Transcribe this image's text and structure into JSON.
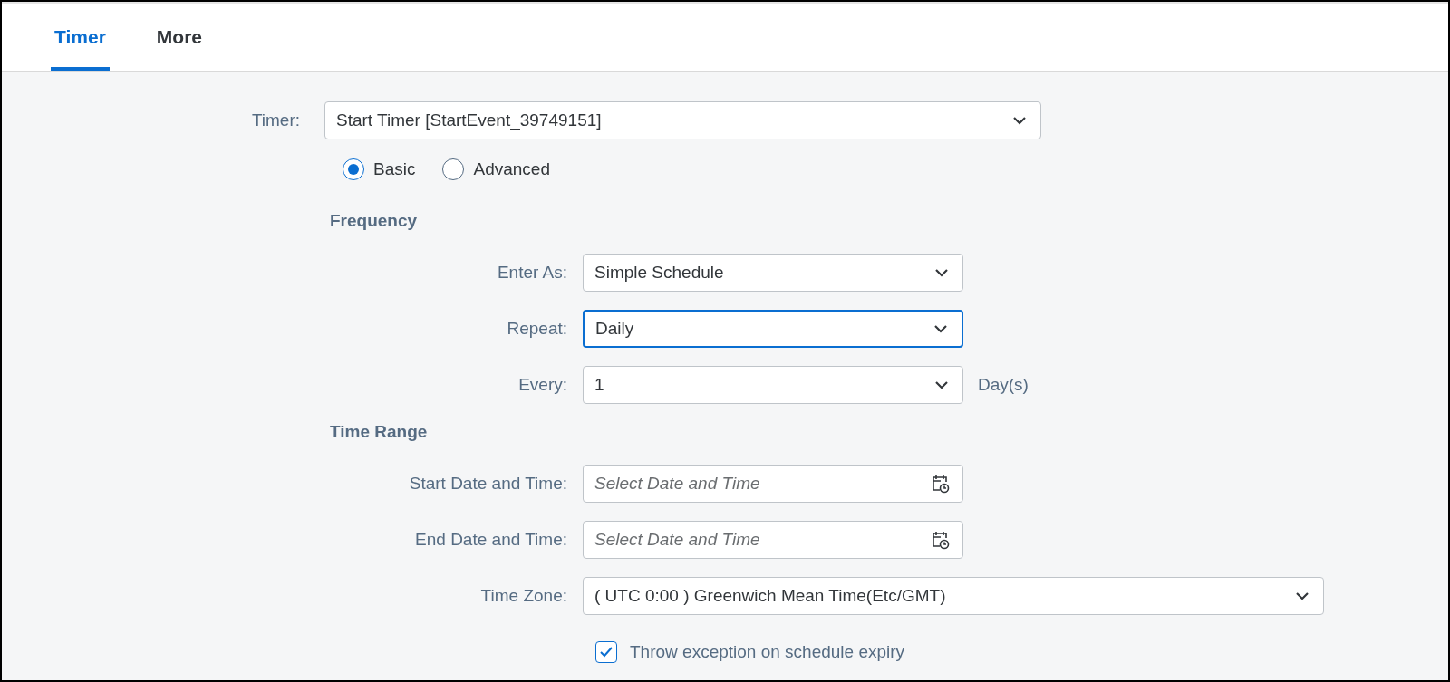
{
  "tabs": [
    {
      "label": "Timer",
      "selected": true
    },
    {
      "label": "More",
      "selected": false
    }
  ],
  "timer": {
    "label": "Timer:",
    "value": "Start Timer [StartEvent_39749151]"
  },
  "mode_options": [
    {
      "label": "Basic",
      "selected": true
    },
    {
      "label": "Advanced",
      "selected": false
    }
  ],
  "sections": [
    {
      "heading": "Frequency",
      "fields": [
        {
          "kind": "select",
          "label": "Enter As:",
          "value": "Simple Schedule",
          "focused": false
        },
        {
          "kind": "select",
          "label": "Repeat:",
          "value": "Daily",
          "focused": true
        },
        {
          "kind": "select",
          "label": "Every:",
          "value": "1",
          "focused": false,
          "suffix": "Day(s)"
        }
      ]
    },
    {
      "heading": "Time Range",
      "fields": [
        {
          "kind": "date",
          "label": "Start Date and Time:",
          "placeholder": "Select Date and Time"
        },
        {
          "kind": "date",
          "label": "End Date and Time:",
          "placeholder": "Select Date and Time"
        },
        {
          "kind": "wide-select",
          "label": "Time Zone:",
          "value": "( UTC 0:00 ) Greenwich Mean Time(Etc/GMT)",
          "focused": false
        }
      ]
    }
  ],
  "expiry_checkbox": {
    "label": "Throw exception on schedule expiry",
    "checked": true
  }
}
